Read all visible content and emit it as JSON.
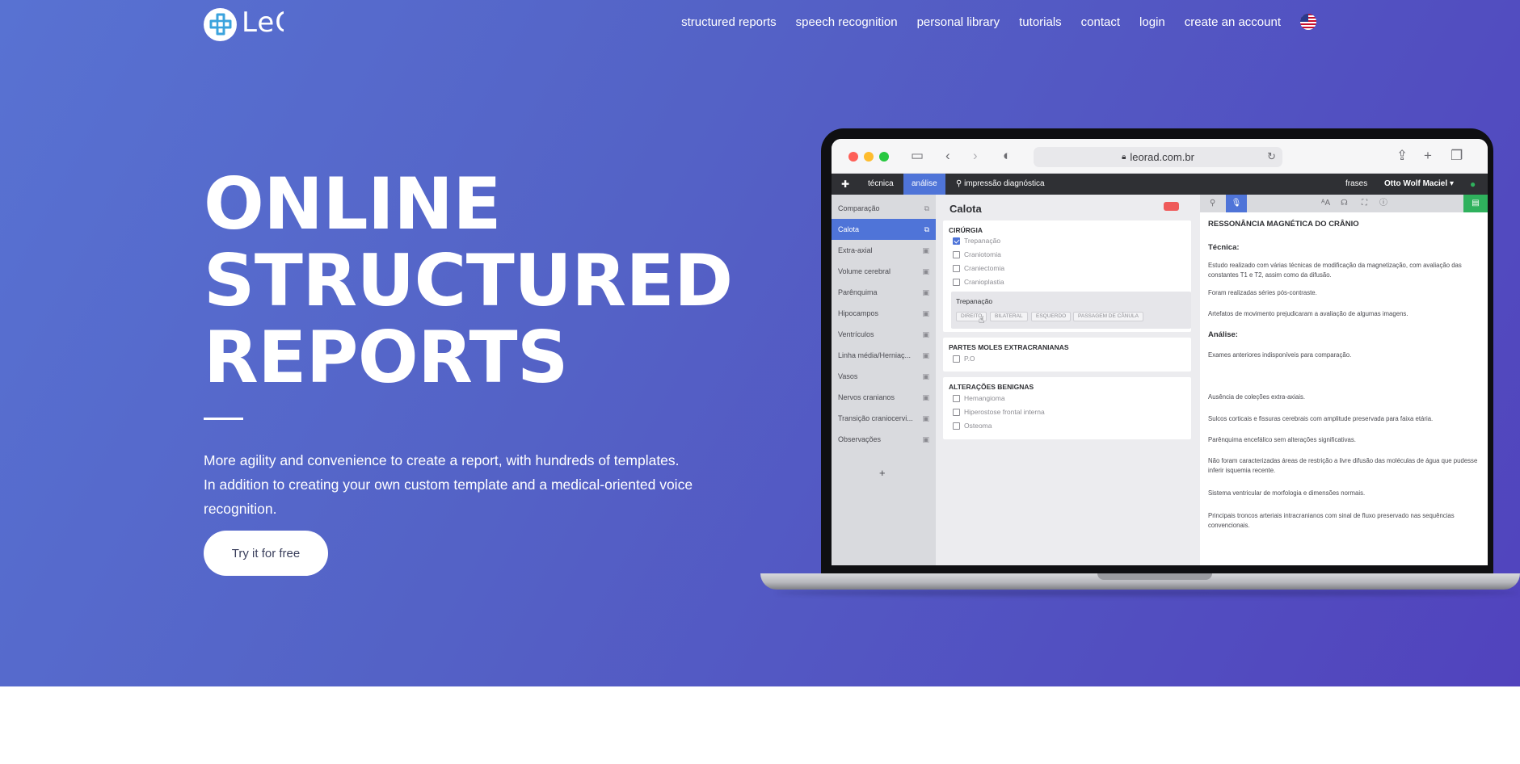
{
  "brand": {
    "name": "Leo"
  },
  "nav": {
    "items": [
      "structured reports",
      "speech recognition",
      "personal library",
      "tutorials",
      "contact",
      "login",
      "create an account"
    ],
    "flag_icon": "us-flag-icon"
  },
  "hero": {
    "headline": [
      "ONLINE",
      "STRUCTURED",
      "REPORTS"
    ],
    "subtitle": [
      "More agility and convenience to create a report, with hundreds of templates.",
      "In addition to creating your own custom template and a medical-oriented voice",
      "recognition."
    ],
    "cta": "Try it for free",
    "colors": {
      "gradient_start": "#5872d2",
      "gradient_end": "#5143bd"
    }
  },
  "mockup": {
    "browser": {
      "url": "leorad.com.br"
    },
    "appbar": {
      "tabs": [
        "técnica",
        "análise"
      ],
      "active_tab": "análise",
      "diagnostic": "impressão diagnóstica",
      "phrases": "frases",
      "user": "Otto Wolf Maciel"
    },
    "sidebar": {
      "items": [
        "Comparação",
        "Calota",
        "Extra-axial",
        "Volume cerebral",
        "Parênquima",
        "Hipocampos",
        "Ventrículos",
        "Linha média/Herniaç...",
        "Vasos",
        "Nervos cranianos",
        "Transição craniocervi...",
        "Observações"
      ],
      "active": "Calota",
      "add": "+"
    },
    "middle": {
      "title": "Calota",
      "sections": [
        {
          "heading": "CIRÚRGIA",
          "options": [
            "Trepanação",
            "Craniotomia",
            "Craniectomia",
            "Cranioplastia"
          ],
          "checked": "Trepanação"
        },
        {
          "heading": "PARTES MOLES EXTRACRANIANAS",
          "options": [
            "P.O"
          ]
        },
        {
          "heading": "ALTERAÇÕES BENIGNAS",
          "options": [
            "Hemangioma",
            "Hiperostose frontal interna",
            "Osteoma"
          ]
        }
      ],
      "sub_panel": {
        "title": "Trepanação",
        "buttons": [
          "DIREITO",
          "BILATERAL",
          "ESQUERDO",
          "PASSAGEM DE CÂNULA"
        ]
      }
    },
    "report": {
      "title": "RESSONÂNCIA MAGNÉTICA DO CRÂNIO",
      "tecnica_heading": "Técnica:",
      "tecnica_lines": [
        "Estudo realizado com várias técnicas de modificação da magnetização, com avaliação das constantes T1 e T2, assim como da difusão.",
        "Foram realizadas séries pós-contraste.",
        "Artefatos de movimento prejudicaram a avaliação de algumas imagens."
      ],
      "analise_heading": "Análise:",
      "analise_lines": [
        "Exames anteriores indisponíveis para comparação.",
        "Ausência de coleções extra-axiais.",
        "Sulcos corticais e fissuras cerebrais com amplitude preservada para faixa etária.",
        "Parênquima encefálico sem alterações significativas.",
        "Não foram caracterizadas áreas de restrição a livre difusão das moléculas de água que pudesse inferir isquemia recente.",
        "Sistema ventricular de morfologia e dimensões normais.",
        "Principais troncos arteriais intracranianos com sinal de fluxo preservado nas sequências convencionais."
      ]
    }
  }
}
